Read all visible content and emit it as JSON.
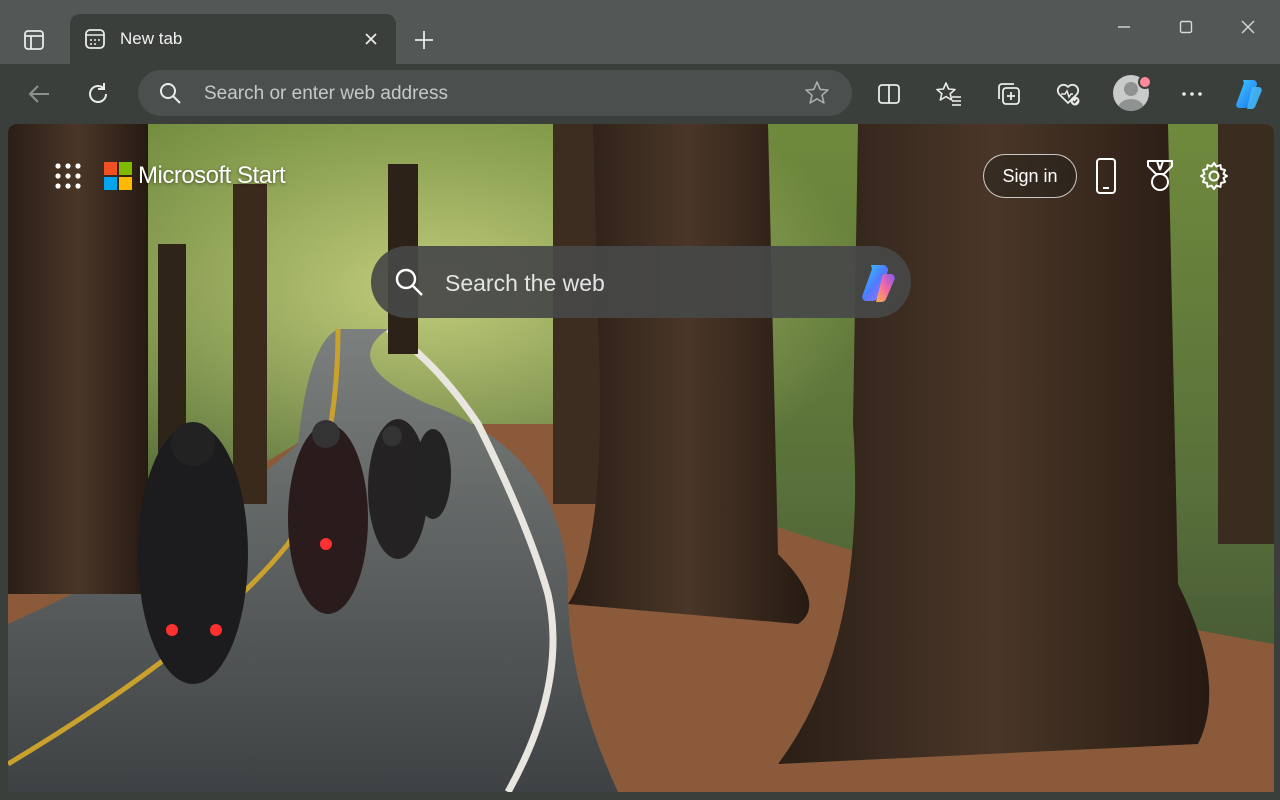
{
  "tab": {
    "title": "New tab"
  },
  "toolbar": {
    "address_placeholder": "Search or enter web address"
  },
  "newtab_page": {
    "brand": "Microsoft Start",
    "signin_label": "Sign in",
    "search_placeholder": "Search the web"
  },
  "icons": [
    "workspaces-icon",
    "newtab-page-icon",
    "close-icon",
    "plus-icon",
    "minimize-icon",
    "maximize-icon",
    "close-window-icon",
    "back-arrow-icon",
    "refresh-icon",
    "search-icon",
    "star-icon",
    "split-screen-icon",
    "favorites-icon",
    "collections-icon",
    "browser-essentials-icon",
    "profile-avatar",
    "more-icon",
    "copilot-icon",
    "apps-grid-icon",
    "microsoft-logo",
    "phone-icon",
    "rewards-icon",
    "gear-icon"
  ],
  "colors": {
    "chrome_dark": "#3a3f3c",
    "titlebar": "#525856",
    "notification_dot": "#ff8a9a"
  }
}
